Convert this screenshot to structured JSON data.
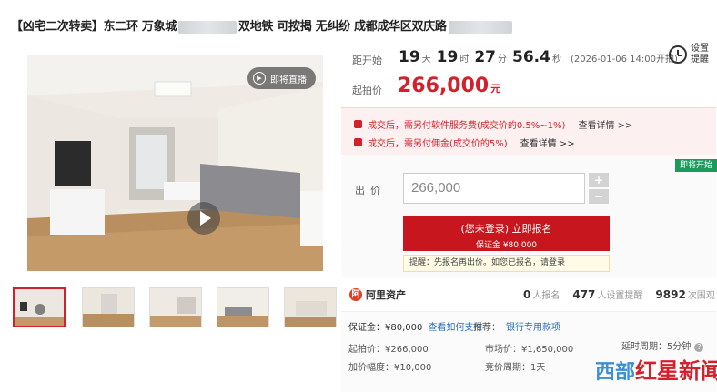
{
  "listing": {
    "title_part1": "【凶宅二次转卖】东二环 万象城",
    "title_part2": "双地铁 可按揭 无纠纷 成都成华区双庆路"
  },
  "media": {
    "live_label": "即将直播",
    "thumbnail_count": 5
  },
  "countdown": {
    "label": "距开始",
    "days": "19",
    "days_unit": "天",
    "hours": "19",
    "hours_unit": "时",
    "minutes": "27",
    "minutes_unit": "分",
    "seconds": "56.4",
    "seconds_unit": "秒",
    "start_time": "(2026-01-06 14:00开拍)"
  },
  "remind": {
    "label": "设置提醒"
  },
  "pricing": {
    "start_label": "起拍价",
    "start_price": "266,000",
    "currency_unit": "元"
  },
  "fees": [
    {
      "text": "成交后，需另付软件服务费(成交价的0.5%~1%)",
      "link": "查看详情 >>"
    },
    {
      "text": "成交后，需另付佣金(成交价的5%)",
      "link": "查看详情 >>"
    }
  ],
  "status_tag": "即将开始",
  "bid": {
    "label": "出价",
    "value": "266,000",
    "plus": "+",
    "minus": "−",
    "signup_line1": "(您未登录) 立即报名",
    "signup_line2": "保证金 ¥80,000",
    "hint": "提醒：先报名再出价。如您已报名，请登录"
  },
  "brand": {
    "logo_char": "阿",
    "name": "阿里资产"
  },
  "stats": [
    {
      "value": "0",
      "label": "人报名"
    },
    {
      "value": "477",
      "label": "人设置提醒"
    },
    {
      "value": "9892",
      "label": "次围观"
    }
  ],
  "details": {
    "deposit": "保证金：¥80,000",
    "deposit_link": "查看如何支付",
    "recommend": "推荐：",
    "recommend_link": "银行专用款项",
    "start_price": "起拍价：¥266,000",
    "market_price": "市场价：¥1,650,000",
    "delay_period": "延时周期：5分钟",
    "increment": "加价幅度：¥10,000",
    "bidding_period": "竞价周期：1天"
  },
  "watermark": {
    "part1": "西部",
    "part2": "红星新闻"
  },
  "colors": {
    "accent_red": "#d4202b",
    "green_tag": "#1a9b5b",
    "link_blue": "#2a6ebd"
  }
}
